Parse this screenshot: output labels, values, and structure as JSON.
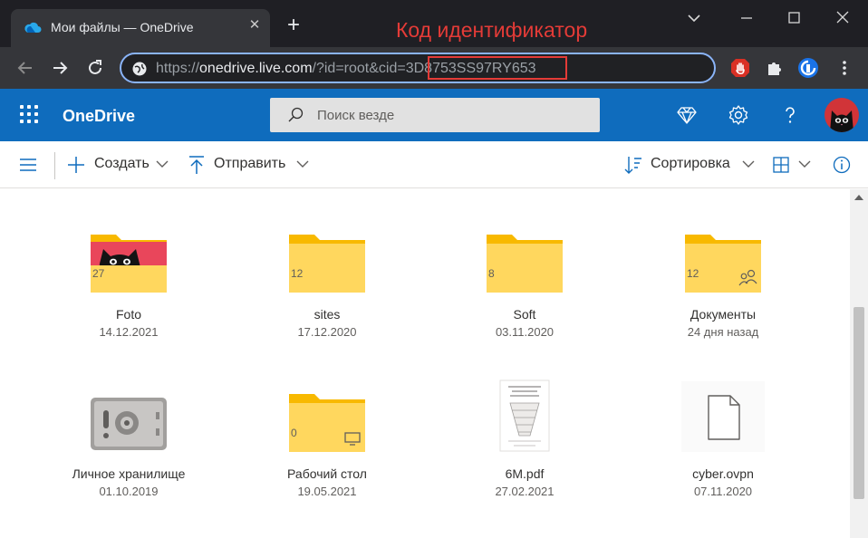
{
  "browser": {
    "tab_title": "Мои файлы — OneDrive",
    "annotation": "Код идентификатор",
    "url_scheme": "https://",
    "url_host": "onedrive.live.com",
    "url_query": "/?id=root&cid=",
    "url_cid": "3D8753SS97RY653"
  },
  "onedrive": {
    "brand": "OneDrive",
    "search_placeholder": "Поиск везде"
  },
  "commands": {
    "create": "Создать",
    "upload": "Отправить",
    "sort": "Сортировка"
  },
  "items": [
    {
      "name": "Foto",
      "date": "14.12.2021",
      "count": "27",
      "kind": "photo-folder"
    },
    {
      "name": "sites",
      "date": "17.12.2020",
      "count": "12",
      "kind": "folder"
    },
    {
      "name": "Soft",
      "date": "03.11.2020",
      "count": "8",
      "kind": "folder"
    },
    {
      "name": "Документы",
      "date": "24 дня назад",
      "count": "12",
      "kind": "shared-folder"
    },
    {
      "name": "Личное хранилище",
      "date": "01.10.2019",
      "count": "",
      "kind": "vault"
    },
    {
      "name": "Рабочий стол",
      "date": "19.05.2021",
      "count": "0",
      "kind": "desktop-folder"
    },
    {
      "name": "6M.pdf",
      "date": "27.02.2021",
      "count": "",
      "kind": "pdf"
    },
    {
      "name": "cyber.ovpn",
      "date": "07.11.2020",
      "count": "",
      "kind": "file"
    }
  ],
  "colors": {
    "od_blue": "#0f6cbd",
    "folder": "#ffd75e",
    "folder_back": "#f8b900",
    "annotation_red": "#e43b37"
  }
}
